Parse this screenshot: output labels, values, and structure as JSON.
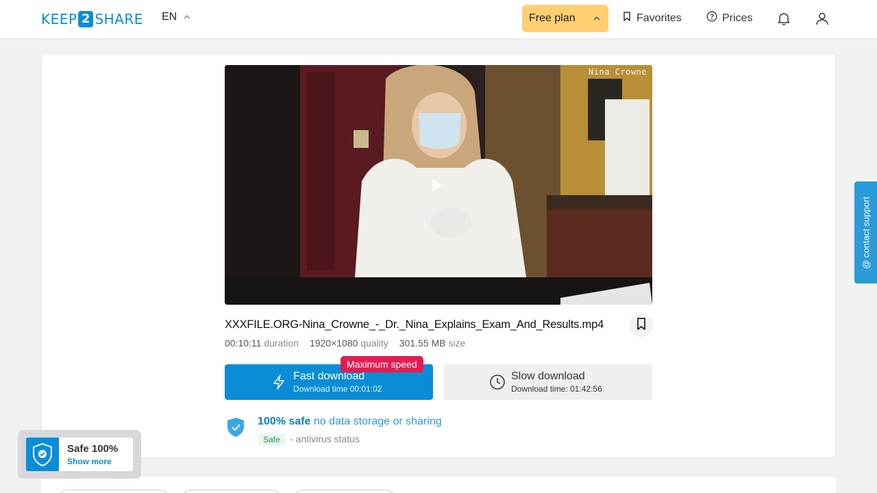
{
  "header": {
    "logo_left": "KEEP",
    "logo_num": "2",
    "logo_right": "SHARE",
    "language": "EN",
    "plan_label": "Free plan",
    "favorites_label": "Favorites",
    "prices_label": "Prices"
  },
  "video": {
    "watermark": "Nina Crowne"
  },
  "file": {
    "name": "XXXFILE.ORG-Nina_Crowne_-_Dr._Nina_Explains_Exam_And_Results.mp4",
    "duration_value": "00:10:11",
    "duration_label": "duration",
    "quality_value": "1920×1080",
    "quality_label": "quality",
    "size_value": "301.55 MB",
    "size_label": "size"
  },
  "download": {
    "badge": "Maximum speed",
    "fast_title": "Fast download",
    "fast_time": "Download time 00:01:02",
    "slow_title": "Slow download",
    "slow_time": "Download time: 01:42:56"
  },
  "safety": {
    "strong": "100% safe",
    "rest": "no data storage or sharing",
    "tag": "Safe",
    "antivirus": "- antivirus status"
  },
  "support": {
    "label": "@ contact support"
  },
  "safe_widget": {
    "title": "Safe 100%",
    "link": "Show more"
  },
  "colors": {
    "accent": "#0a8dd6",
    "plan": "#ffcf72",
    "badge": "#e21d53"
  }
}
